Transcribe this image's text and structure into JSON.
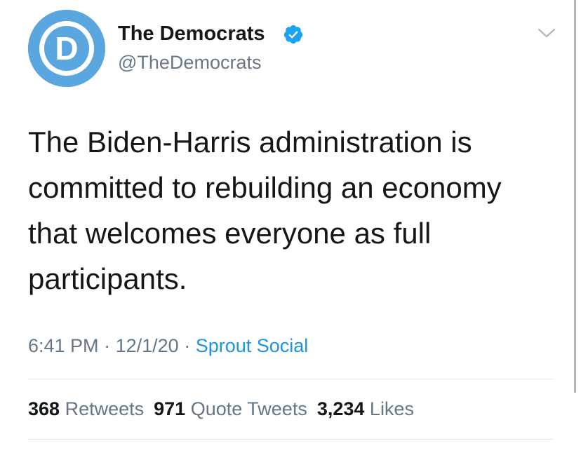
{
  "author": {
    "name": "The Democrats",
    "handle": "@TheDemocrats",
    "avatar_letter": "D",
    "avatar_color": "#5aa6de",
    "verified": true,
    "verified_icon": "verified-badge-icon",
    "verified_color": "#1da1f2"
  },
  "menu": {
    "icon": "chevron-down-icon"
  },
  "tweet": {
    "lines": [
      "The Biden-Harris administration is",
      "committed to rebuilding an economy",
      "that welcomes everyone as full",
      "participants."
    ]
  },
  "meta": {
    "time": "6:41 PM",
    "separator": "·",
    "date": "12/1/20",
    "source": "Sprout Social"
  },
  "stats": {
    "retweets_count": "368",
    "retweets_label": "Retweets",
    "quotes_count": "971",
    "quotes_label": "Quote Tweets",
    "likes_count": "3,234",
    "likes_label": "Likes"
  },
  "colors": {
    "text": "#14171a",
    "secondary": "#657786",
    "link": "#1b95e0",
    "divider": "#e1e8ed"
  }
}
